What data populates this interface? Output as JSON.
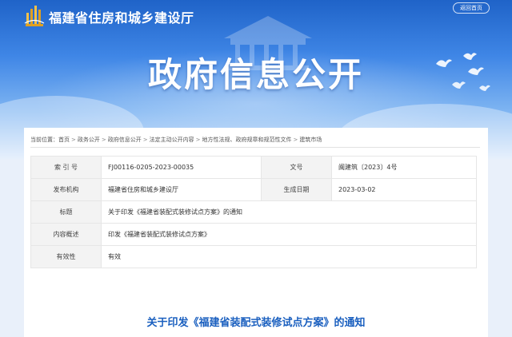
{
  "header": {
    "site_title": "福建省住房和城乡建设厅",
    "return_home": "返回首页",
    "banner_title": "政府信息公开"
  },
  "breadcrumb": {
    "prefix": "当前位置：",
    "items": [
      "首页",
      "政务公开",
      "政府信息公开",
      "法定主动公开内容",
      "地方性法规、政府规章和规范性文件",
      "建筑市场"
    ]
  },
  "meta": {
    "index_label": "索 引 号",
    "index_value": "FJ00116-0205-2023-00035",
    "doc_no_label": "文号",
    "doc_no_value": "闽建筑〔2023〕4号",
    "issuer_label": "发布机构",
    "issuer_value": "福建省住房和城乡建设厅",
    "date_label": "生成日期",
    "date_value": "2023-03-02",
    "title_label": "标题",
    "title_value": "关于印发《福建省装配式装修试点方案》的通知",
    "summary_label": "内容概述",
    "summary_value": "印发《福建省装配式装修试点方案》",
    "validity_label": "有效性",
    "validity_value": "有效"
  },
  "article": {
    "title": "关于印发《福建省装配式装修试点方案》的通知"
  },
  "colors": {
    "banner_blue": "#2f74d8",
    "title_blue": "#1a5fbf",
    "logo_gold": "#e0a020"
  },
  "icons": {
    "logo": "building-logo-icon",
    "doves": "dove-icon"
  }
}
